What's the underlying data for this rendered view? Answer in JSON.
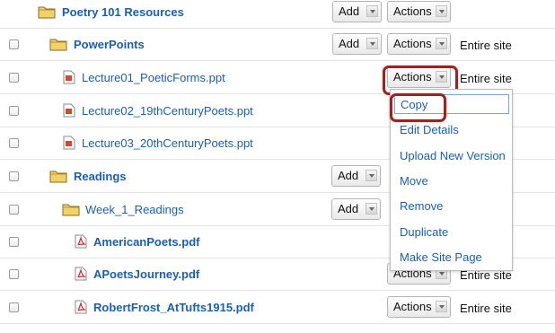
{
  "labels": {
    "add": "Add",
    "actions": "Actions",
    "scope": "Entire site"
  },
  "rows": [
    {
      "name": "Poetry 101 Resources"
    },
    {
      "name": "PowerPoints"
    },
    {
      "name": "Lecture01_PoeticForms.ppt"
    },
    {
      "name": "Lecture02_19thCenturyPoets.ppt"
    },
    {
      "name": "Lecture03_20thCenturyPoets.ppt"
    },
    {
      "name": "Readings"
    },
    {
      "name": "Week_1_Readings"
    },
    {
      "name": "AmericanPoets.pdf"
    },
    {
      "name": "APoetsJourney.pdf"
    },
    {
      "name": "RobertFrost_AtTufts1915.pdf"
    }
  ],
  "menu": {
    "items": [
      "Copy",
      "Edit Details",
      "Upload New Version",
      "Move",
      "Remove",
      "Duplicate",
      "Make Site Page"
    ]
  },
  "icons": {
    "folder": "folder-icon",
    "ppt": "powerpoint-file-icon",
    "pdf": "pdf-file-icon",
    "dropdown": "chevron-down-icon"
  },
  "colors": {
    "link": "#1a5fb4",
    "highlight": "#a3201f",
    "folder": "#e8c04a"
  }
}
